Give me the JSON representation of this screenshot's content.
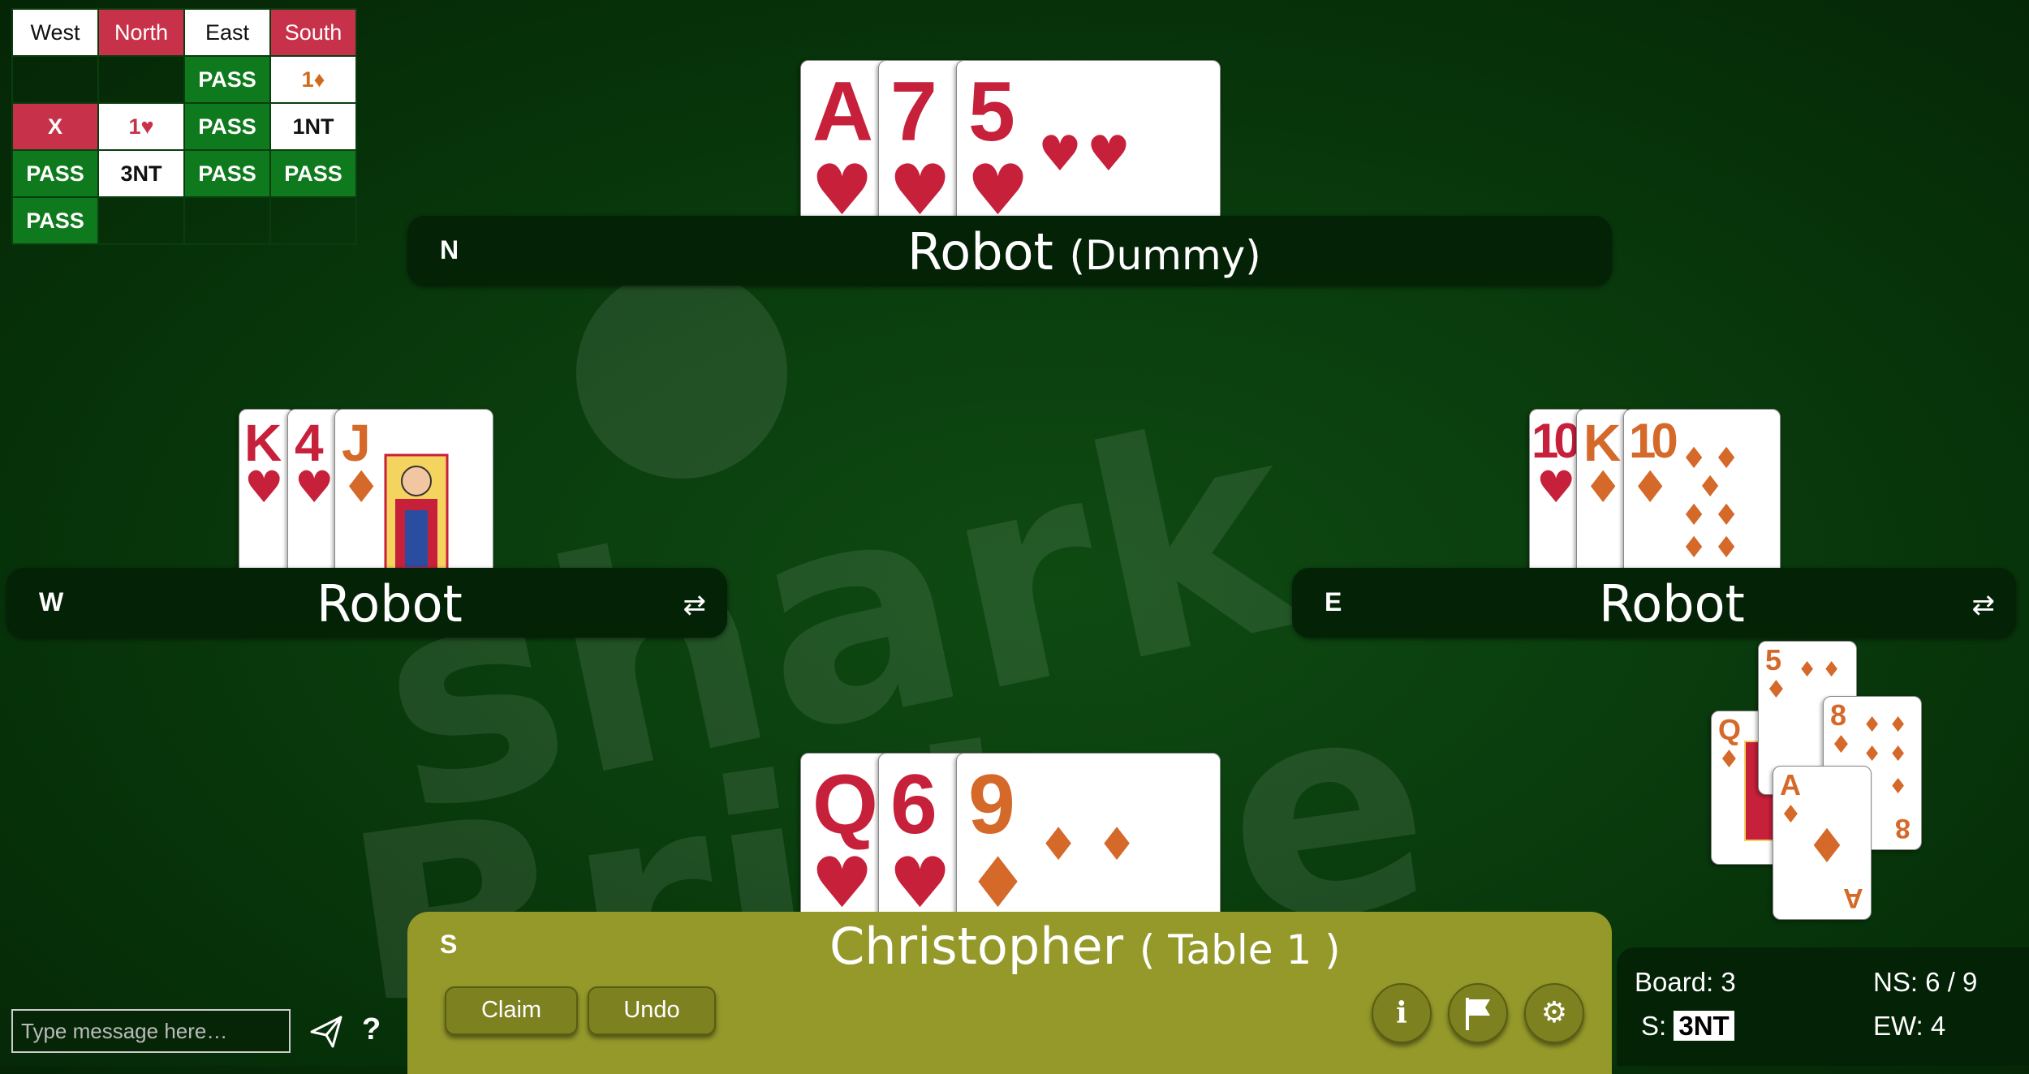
{
  "bidding": {
    "headers": [
      "West",
      "North",
      "East",
      "South"
    ],
    "rows": [
      [
        "",
        "",
        "PASS",
        "1♦"
      ],
      [
        "X",
        "1♥",
        "PASS",
        "1NT"
      ],
      [
        "PASS",
        "3NT",
        "PASS",
        "PASS"
      ],
      [
        "PASS",
        "",
        "",
        ""
      ]
    ]
  },
  "north": {
    "dir": "N",
    "name": "Robot",
    "role": "(Dummy)"
  },
  "west": {
    "dir": "W",
    "name": "Robot",
    "swap_icon": "swap-icon"
  },
  "east": {
    "dir": "E",
    "name": "Robot",
    "swap_icon": "swap-icon"
  },
  "south": {
    "dir": "S",
    "name": "Christopher",
    "table": "( Table 1 )"
  },
  "north_cards": [
    {
      "rank": "A",
      "suit": "♥"
    },
    {
      "rank": "7",
      "suit": "♥"
    },
    {
      "rank": "5",
      "suit": "♥"
    }
  ],
  "west_cards": [
    {
      "rank": "K",
      "suit": "♥"
    },
    {
      "rank": "4",
      "suit": "♥"
    },
    {
      "rank": "J",
      "suit": "♦"
    }
  ],
  "east_cards": [
    {
      "rank": "10",
      "suit": "♥"
    },
    {
      "rank": "K",
      "suit": "♦"
    },
    {
      "rank": "10",
      "suit": "♦"
    }
  ],
  "south_cards": [
    {
      "rank": "Q",
      "suit": "♥"
    },
    {
      "rank": "6",
      "suit": "♥"
    },
    {
      "rank": "9",
      "suit": "♦"
    }
  ],
  "trick_cards": [
    {
      "rank": "Q",
      "suit": "♦",
      "seat": "W"
    },
    {
      "rank": "5",
      "suit": "♦",
      "seat": "N"
    },
    {
      "rank": "8",
      "suit": "♦",
      "seat": "E"
    },
    {
      "rank": "A",
      "suit": "♦",
      "seat": "S"
    }
  ],
  "buttons": {
    "claim": "Claim",
    "undo": "Undo"
  },
  "icons": {
    "info": "info-icon",
    "flag": "flag-icon",
    "settings": "gear-icon",
    "send": "send-icon",
    "help": "?"
  },
  "score": {
    "board_label": "Board: 3",
    "contract_prefix": "S:",
    "contract": "3NT",
    "ns": "NS: 6 / 9",
    "ew": "EW: 4"
  },
  "chat": {
    "placeholder": "Type message here…"
  },
  "colors": {
    "felt": "#0a3d0e",
    "bid_red": "#c7324a",
    "bid_green": "#0f7a1d",
    "south_panel": "#95992a"
  }
}
